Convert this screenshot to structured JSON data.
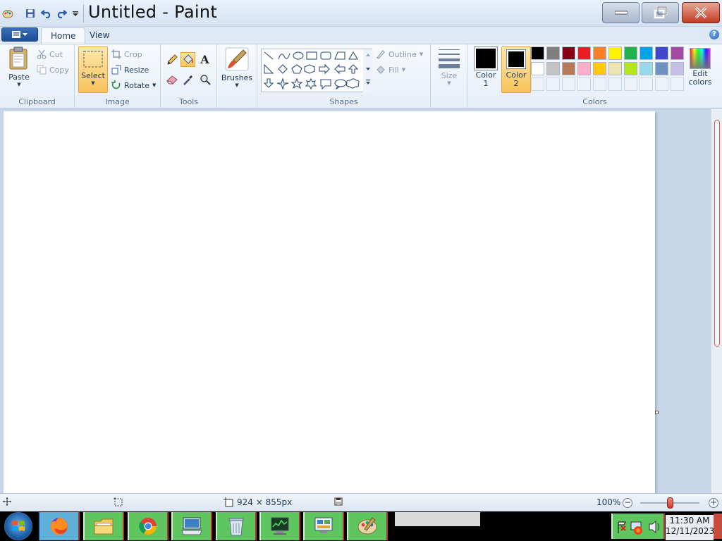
{
  "app": {
    "title": "Untitled - Paint"
  },
  "tabs": [
    {
      "label": "Home"
    },
    {
      "label": "View"
    }
  ],
  "ribbon": {
    "clipboard": {
      "label": "Clipboard",
      "paste": "Paste",
      "cut": "Cut",
      "copy": "Copy"
    },
    "image": {
      "label": "Image",
      "select": "Select",
      "crop": "Crop",
      "resize": "Resize",
      "rotate": "Rotate"
    },
    "tools": {
      "label": "Tools"
    },
    "brushes": {
      "label": "Brushes"
    },
    "shapes": {
      "label": "Shapes",
      "outline": "Outline",
      "fill": "Fill"
    },
    "size": {
      "label": "Size"
    },
    "colors": {
      "label": "Colors",
      "color1_line1": "Color",
      "color1_line2": "1",
      "color2_line1": "Color",
      "color2_line2": "2",
      "edit_line1": "Edit",
      "edit_line2": "colors",
      "color1": "#000000",
      "color2": "#000000",
      "palette_row1": [
        "#000000",
        "#7f7f7f",
        "#880015",
        "#ed1c24",
        "#ff7f27",
        "#fff200",
        "#22b14c",
        "#00a2e8",
        "#3f48cc",
        "#a349a4"
      ],
      "palette_row2": [
        "#ffffff",
        "#c3c3c3",
        "#b97a57",
        "#ffaec9",
        "#ffc90e",
        "#efe4b0",
        "#b5e61d",
        "#99d9ea",
        "#7092be",
        "#c8bfe7"
      ]
    }
  },
  "status": {
    "image_size": "924 × 855px",
    "zoom": "100%"
  },
  "taskbar": {
    "time": "11:30 AM",
    "date": "12/11/2023"
  }
}
